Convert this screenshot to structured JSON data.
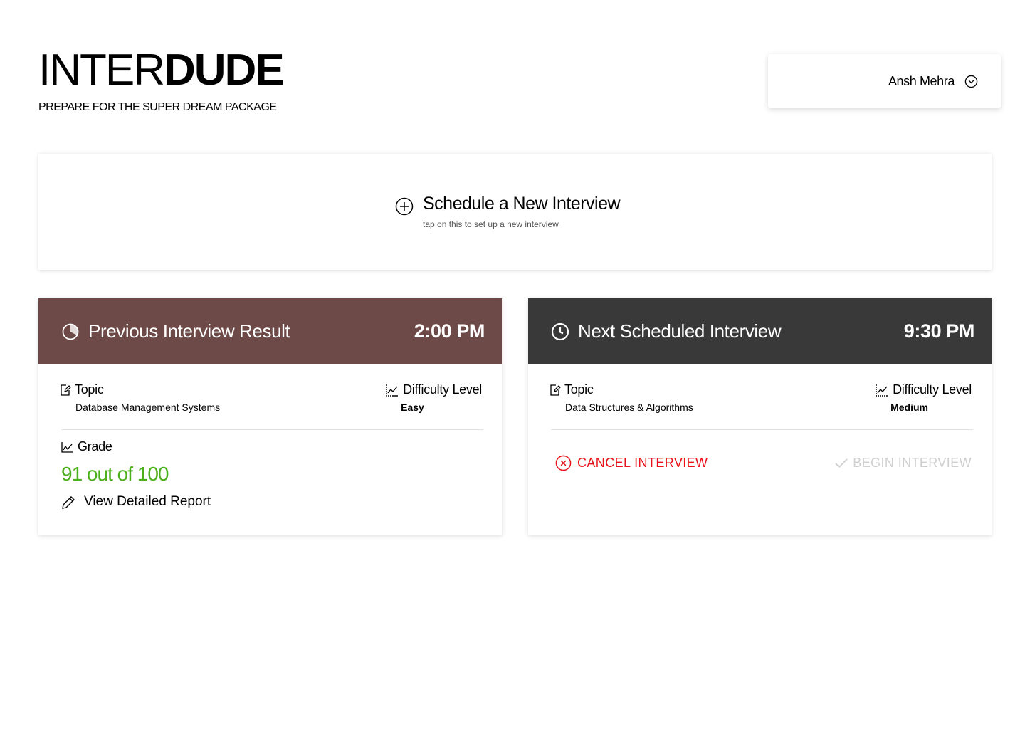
{
  "brand": {
    "light": "INTER",
    "bold": "DUDE",
    "tagline": "PREPARE FOR THE SUPER DREAM PACKAGE"
  },
  "user": {
    "name": "Ansh Mehra"
  },
  "schedule": {
    "title": "Schedule a New Interview",
    "subtitle": "tap on this to set up a new interview"
  },
  "previous": {
    "title_strong": "Previous",
    "title_rest": " Interview Result",
    "time": "2:00 PM",
    "color": "#6d4a48",
    "topic_label": "Topic",
    "topic": "Database Management Systems",
    "difficulty_label": "Difficulty Level",
    "difficulty": "Easy",
    "grade_label": "Grade",
    "score": "91 out of 100",
    "report": "View Detailed Report"
  },
  "next": {
    "title_strong": "Next",
    "title_rest": " Scheduled Interview",
    "time": "9:30 PM",
    "color": "#393939",
    "topic_label": "Topic",
    "topic": "Data Structures & Algorithms",
    "difficulty_label": "Difficulty Level",
    "difficulty": "Medium",
    "cancel": "CANCEL INTERVIEW",
    "begin": "BEGIN INTERVIEW"
  }
}
